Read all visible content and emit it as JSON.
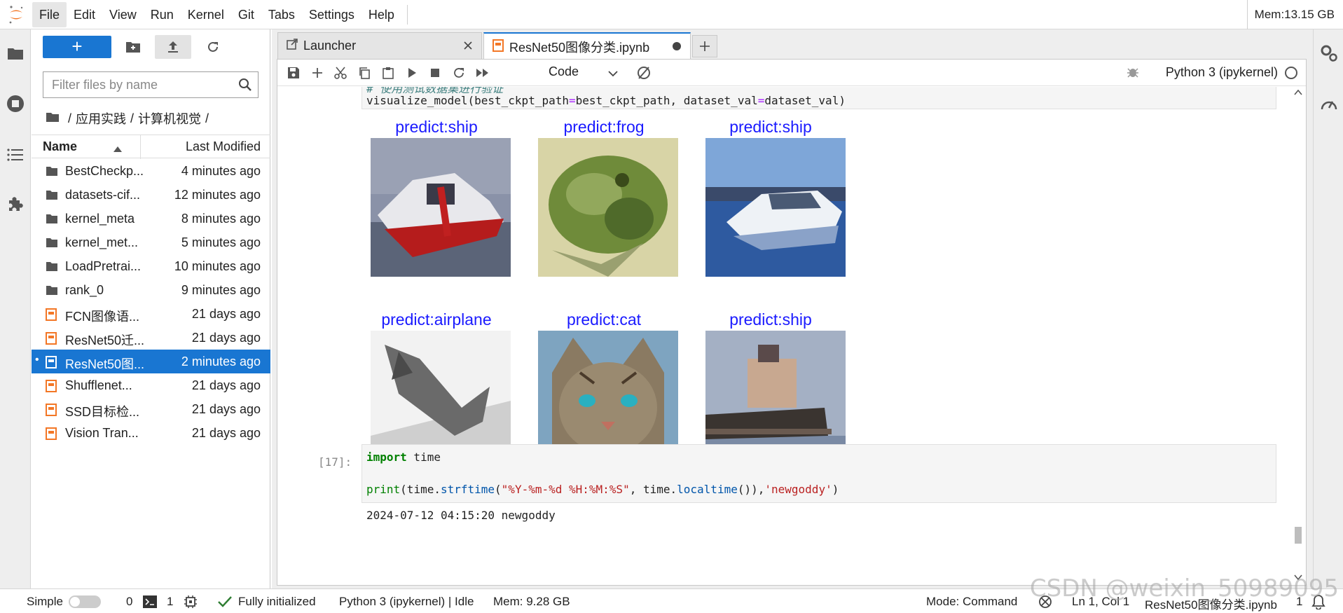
{
  "menubar": {
    "items": [
      "File",
      "Edit",
      "View",
      "Run",
      "Kernel",
      "Git",
      "Tabs",
      "Settings",
      "Help"
    ],
    "memory": "Mem:13.15 GB"
  },
  "filebrowser": {
    "new_label": "+",
    "filter_placeholder": "Filter files by name",
    "breadcrumb": [
      "/",
      "应用实践",
      "/",
      "计算机视觉",
      "/"
    ],
    "col_name": "Name",
    "col_modified": "Last Modified",
    "files": [
      {
        "name": "BestCheckp...",
        "modified": "4 minutes ago",
        "type": "folder"
      },
      {
        "name": "datasets-cif...",
        "modified": "12 minutes ago",
        "type": "folder"
      },
      {
        "name": "kernel_meta",
        "modified": "8 minutes ago",
        "type": "folder"
      },
      {
        "name": "kernel_met...",
        "modified": "5 minutes ago",
        "type": "folder"
      },
      {
        "name": "LoadPretrai...",
        "modified": "10 minutes ago",
        "type": "folder"
      },
      {
        "name": "rank_0",
        "modified": "9 minutes ago",
        "type": "folder"
      },
      {
        "name": "FCN图像语...",
        "modified": "21 days ago",
        "type": "notebook"
      },
      {
        "name": "ResNet50迁...",
        "modified": "21 days ago",
        "type": "notebook"
      },
      {
        "name": "ResNet50图...",
        "modified": "2 minutes ago",
        "type": "notebook",
        "selected": true
      },
      {
        "name": "Shufflenet...",
        "modified": "21 days ago",
        "type": "notebook"
      },
      {
        "name": "SSD目标检...",
        "modified": "21 days ago",
        "type": "notebook"
      },
      {
        "name": "Vision Tran...",
        "modified": "21 days ago",
        "type": "notebook"
      }
    ]
  },
  "tabs": [
    {
      "label": "Launcher",
      "active": false
    },
    {
      "label": "ResNet50图像分类.ipynb",
      "active": true
    }
  ],
  "toolbar": {
    "cell_type": "Code",
    "kernel": "Python 3 (ipykernel)"
  },
  "notebook": {
    "cell1_comment": "# 使用测试数据集进行验证",
    "cell1_code": [
      "visualize_model(best_ckpt_path",
      "=",
      "best_ckpt_path, dataset_val",
      "=",
      "dataset_val)"
    ],
    "predictions": [
      {
        "label": "predict:ship",
        "image": "red-white-boat"
      },
      {
        "label": "predict:frog",
        "image": "green-frog"
      },
      {
        "label": "predict:ship",
        "image": "white-speedboat"
      },
      {
        "label": "predict:airplane",
        "image": "gray-airplane"
      },
      {
        "label": "predict:cat",
        "image": "tabby-cat"
      },
      {
        "label": "predict:ship",
        "image": "cargo-ship"
      }
    ],
    "cell2_prompt": "[17]:",
    "cell2_line1_kw": "import",
    "cell2_line1_rest": " time",
    "cell2_line2": {
      "fn1": "print",
      "p1": "(time.",
      "fn2": "strftime",
      "p2": "(",
      "fmt": "\"%Y-%m-%d %H:%M:%S\"",
      "p3": ", time.",
      "fn3": "localtime",
      "p4": "()),",
      "arg": "'newgoddy'",
      "p5": ")"
    },
    "cell2_output": "2024-07-12 04:15:20 newgoddy"
  },
  "statusbar": {
    "mode_label": "Simple",
    "terminals": "0",
    "kernels": "1",
    "initialized": "Fully initialized",
    "kernel_status": "Python 3 (ipykernel) | Idle",
    "memory": "Mem: 9.28 GB",
    "command_mode": "Mode: Command",
    "cursor": "Ln 1, Col 1",
    "filename": "ResNet50图像分类.ipynb",
    "notifications": "1"
  },
  "watermark": "CSDN @weixin_50989095",
  "colors": {
    "accent": "#1976d2",
    "prediction_text": "#1a1aff",
    "notebook_icon": "#f37726"
  }
}
